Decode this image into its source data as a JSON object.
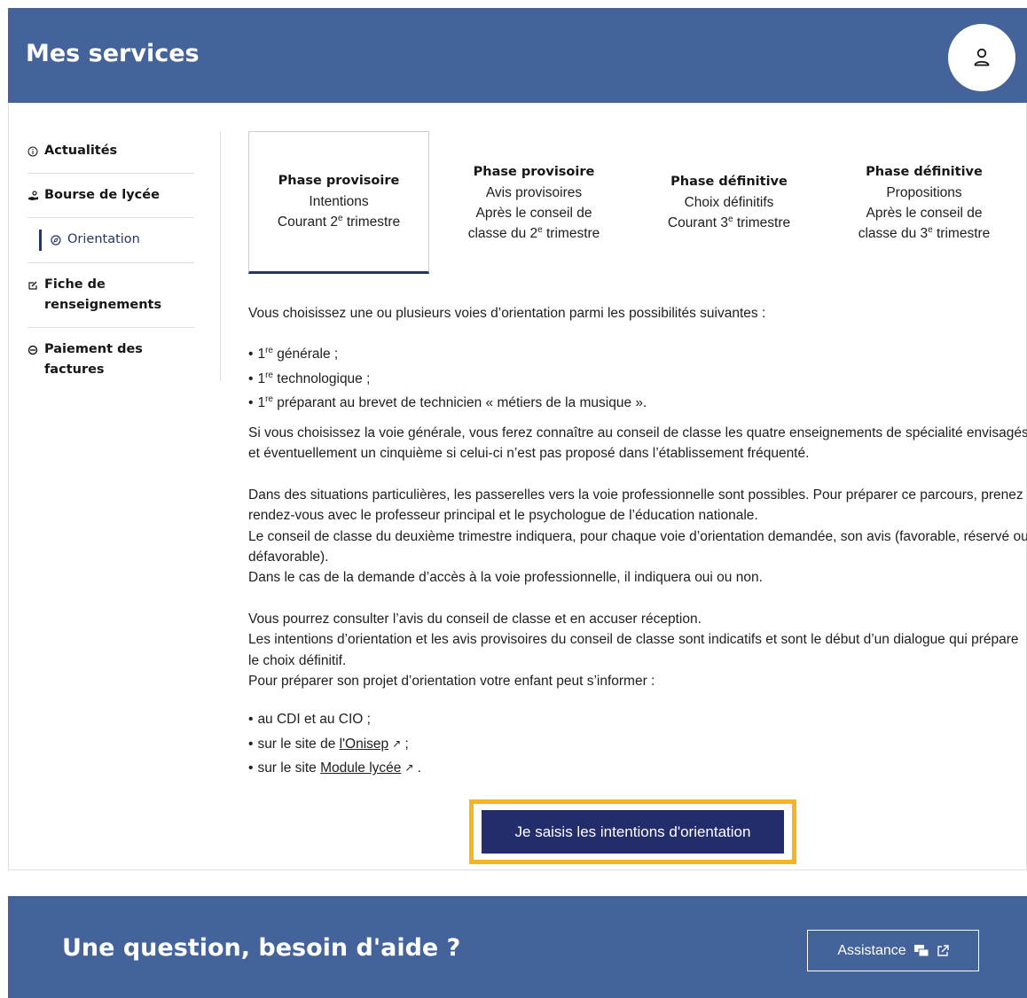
{
  "header": {
    "title": "Mes services",
    "account_icon": "user-icon"
  },
  "sidebar": {
    "items": [
      {
        "label": "Actualités",
        "icon": "info-icon"
      },
      {
        "label": "Bourse de lycée",
        "icon": "hand-coins-icon"
      },
      {
        "label": "Orientation",
        "icon": "compass-icon"
      },
      {
        "label": "Fiche de renseignements",
        "icon": "edit-icon"
      },
      {
        "label": "Paiement des factures",
        "icon": "payment-icon"
      }
    ]
  },
  "tabs": [
    {
      "title": "Phase provisoire",
      "line1": "Intentions",
      "line2": "Courant 2",
      "line2_sup": "e",
      "line2_after": " trimestre"
    },
    {
      "title": "Phase provisoire",
      "line1": "Avis provisoires",
      "line2": "Après le conseil de classe du 2",
      "line2_sup": "e",
      "line2_after": " trimestre"
    },
    {
      "title": "Phase définitive",
      "line1": "Choix définitifs",
      "line2": "Courant 3",
      "line2_sup": "e",
      "line2_after": " trimestre"
    },
    {
      "title": "Phase définitive",
      "line1": "Propositions",
      "line2": "Après le conseil de classe du 3",
      "line2_sup": "e",
      "line2_after": " trimestre"
    }
  ],
  "content": {
    "intro": "Vous choisissez une ou plusieurs voies d’orientation parmi les possibilités suivantes :",
    "options": [
      {
        "num": "1",
        "sup": "re",
        "text": " générale ;"
      },
      {
        "num": "1",
        "sup": "re",
        "text": " technologique ;"
      },
      {
        "num": "1",
        "sup": "re",
        "text": " préparant au brevet de technicien « métiers de la musique »."
      }
    ],
    "p1": "Si vous choisissez la voie générale, vous ferez connaître au conseil de classe les quatre enseignements de spécialité envisagés et éventuellement un cinquième si celui-ci n’est pas proposé dans l’établissement fréquenté.",
    "p2a": "Dans des situations particulières, les passerelles vers la voie professionnelle sont possibles. Pour préparer ce parcours, prenez rendez-vous avec le professeur principal et le psychologue de l’éducation nationale.",
    "p2b": "Le conseil de classe du deuxième trimestre indiquera, pour chaque voie d’orientation demandée, son avis (favorable, réservé ou défavorable).",
    "p2c": "Dans le cas de la demande d’accès à la voie professionnelle, il indiquera oui ou non.",
    "p3a": "Vous pourrez consulter l’avis du conseil de classe et en accuser réception.",
    "p3b": "Les intentions d’orientation et les avis provisoires du conseil de classe sont indicatifs et sont le début d’un dialogue qui prépare le choix définitif.",
    "p3c": "Pour préparer son projet d’orientation votre enfant peut s’informer :",
    "info_1": "au CDI et au CIO ;",
    "info_2_pre": "sur le site de ",
    "info_2_link": "l'Onisep",
    "info_2_post": " ;",
    "info_3_pre": "sur le site ",
    "info_3_link": "Module lycée",
    "info_3_post": " ."
  },
  "cta": {
    "label": "Je saisis les intentions d'orientation"
  },
  "footer": {
    "title": "Une question, besoin d'aide ?",
    "assist_label": "Assistance"
  }
}
